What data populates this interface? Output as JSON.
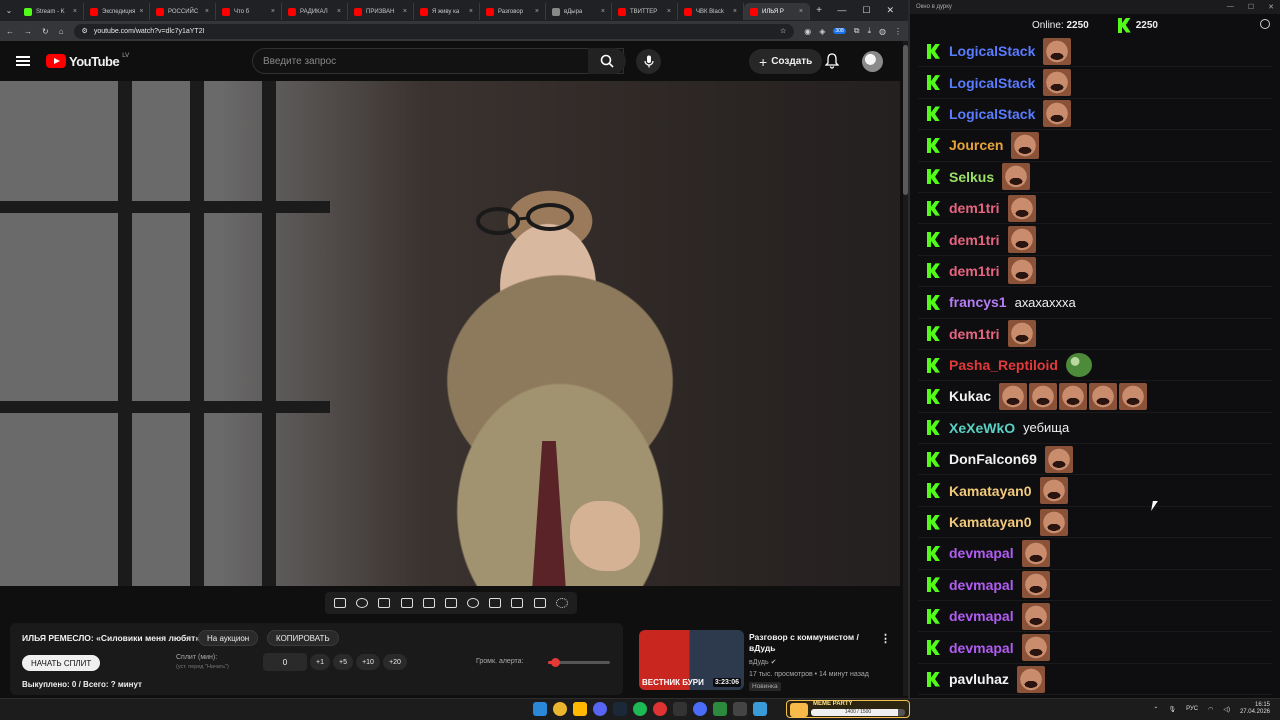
{
  "browser": {
    "tabs": [
      {
        "label": "Stream - K",
        "color": "#53fc18"
      },
      {
        "label": "Экспедиция",
        "color": "#ff0000"
      },
      {
        "label": "РОССИЙС",
        "color": "#ff0000"
      },
      {
        "label": "Что б",
        "color": "#ff0000"
      },
      {
        "label": "РАДИКАЛ",
        "color": "#ff0000"
      },
      {
        "label": "ПРИЗВАН",
        "color": "#ff0000"
      },
      {
        "label": "Я живу ка",
        "color": "#ff0000"
      },
      {
        "label": "Разговор",
        "color": "#ff0000"
      },
      {
        "label": "вДыра",
        "color": "#888888"
      },
      {
        "label": "ТВИТТЕР",
        "color": "#ff0000"
      },
      {
        "label": "ЧВК Black",
        "color": "#ff0000"
      },
      {
        "label": "ИЛЬЯ Р",
        "color": "#ff0000"
      }
    ],
    "url": "youtube.com/watch?v=dlc7y1aYT2I",
    "ext_badge": "308"
  },
  "youtube": {
    "logo_word": "YouTube",
    "country": "LV",
    "search_placeholder": "Введите запрос",
    "create_label": "Создать"
  },
  "split": {
    "title": "ИЛЬЯ РЕМЕСЛО: «Силовики меня любят»",
    "auction_label": "На аукцион",
    "copy_label": "КОПИРОВАТЬ",
    "start_label": "НАЧАТЬ СПЛИТ",
    "split_min_label": "Сплит (мин):",
    "split_min_sub": "(уст. перед \"Начать\")",
    "split_value": "0",
    "increments": [
      "+1",
      "+5",
      "+10",
      "+20"
    ],
    "volume_label": "Громк. алерта:",
    "volume_level": 0.12,
    "status": "Выкуплено: 0 / Всего: ? минут"
  },
  "recommended": {
    "thumb_text": "ВЕСТНИК БУРИ",
    "duration": "3:23:06",
    "title": "Разговор с коммунистом / вДудь",
    "channel": "вДудь",
    "meta": "17 тыс. просмотров • 14 минут назад",
    "badge": "Новинка"
  },
  "chat": {
    "window_title": "Окно в дурку",
    "online_label": "Online:",
    "online_count": "2250",
    "kick_count": "2250",
    "messages": [
      {
        "user": "LogicalStack",
        "color": "#5a7cff",
        "text": "",
        "emotes": 1
      },
      {
        "user": "LogicalStack",
        "color": "#5a7cff",
        "text": "",
        "emotes": 1
      },
      {
        "user": "LogicalStack",
        "color": "#5a7cff",
        "text": "",
        "emotes": 1
      },
      {
        "user": "Jourcen",
        "color": "#e8a33b",
        "text": "",
        "emotes": 1
      },
      {
        "user": "Selkus",
        "color": "#9be067",
        "text": "",
        "emotes": 1
      },
      {
        "user": "dem1tri",
        "color": "#e86480",
        "text": "",
        "emotes": 1
      },
      {
        "user": "dem1tri",
        "color": "#e86480",
        "text": "",
        "emotes": 1
      },
      {
        "user": "dem1tri",
        "color": "#e86480",
        "text": "",
        "emotes": 1
      },
      {
        "user": "francys1",
        "color": "#b57cf5",
        "text": "ахахахххa",
        "emotes": 0
      },
      {
        "user": "dem1tri",
        "color": "#e86480",
        "text": "",
        "emotes": 1
      },
      {
        "user": "Pasha_Reptiloid",
        "color": "#e23a3a",
        "text": "",
        "emotes": 0,
        "pepe": true
      },
      {
        "user": "Kukac",
        "color": "#f2f2f2",
        "text": "",
        "emotes": 5
      },
      {
        "user": "XeXeWkO",
        "color": "#5ad1c2",
        "text": "уебища",
        "emotes": 0
      },
      {
        "user": "DonFalcon69",
        "color": "#f2f2f2",
        "text": "",
        "emotes": 1
      },
      {
        "user": "Kamatayan0",
        "color": "#f2c97a",
        "text": "",
        "emotes": 1
      },
      {
        "user": "Kamatayan0",
        "color": "#f2c97a",
        "text": "",
        "emotes": 1
      },
      {
        "user": "devmapal",
        "color": "#b15cf2",
        "text": "",
        "emotes": 1
      },
      {
        "user": "devmapal",
        "color": "#b15cf2",
        "text": "",
        "emotes": 1
      },
      {
        "user": "devmapal",
        "color": "#b15cf2",
        "text": "",
        "emotes": 1
      },
      {
        "user": "devmapal",
        "color": "#b15cf2",
        "text": "",
        "emotes": 1
      },
      {
        "user": "pavluhaz",
        "color": "#f2f2f2",
        "text": "",
        "emotes": 1
      }
    ]
  },
  "taskbar": {
    "meme_title": "MEME PARTY",
    "meme_value": "1400 / 1500",
    "meme_progress": 0.93,
    "lang": "РУС",
    "time": "16:15",
    "date": "27.04.2026"
  }
}
